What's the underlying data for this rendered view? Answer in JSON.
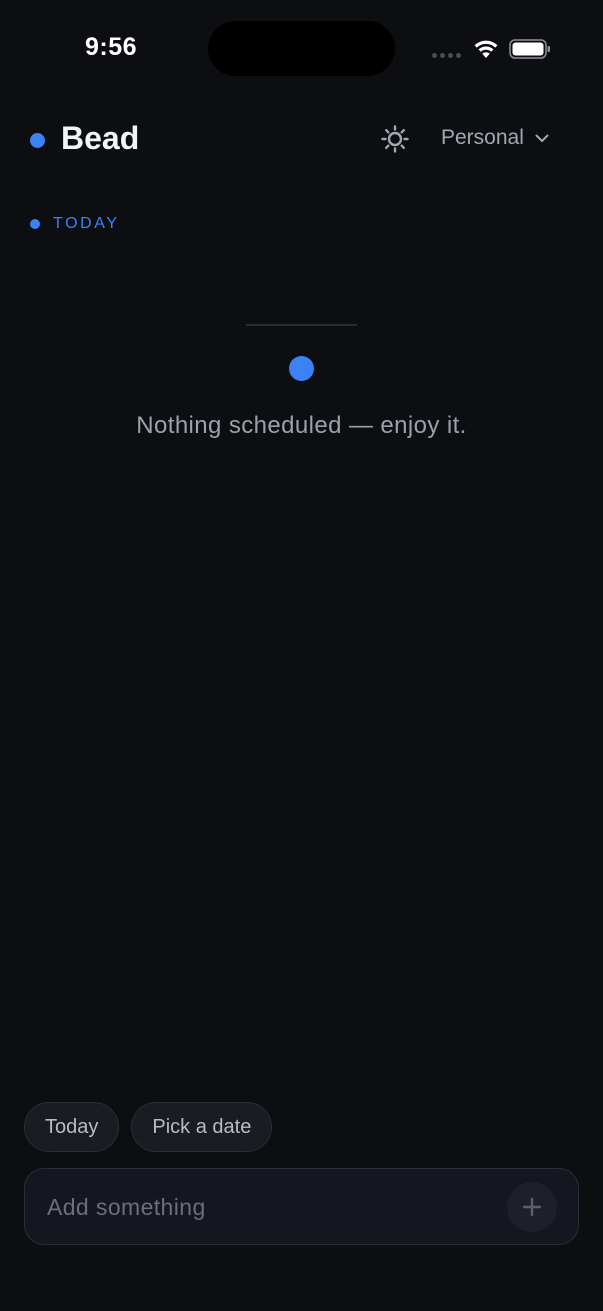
{
  "status_bar": {
    "time": "9:56",
    "icons": [
      "cellular-signal-icon",
      "wifi-icon",
      "battery-icon"
    ]
  },
  "header": {
    "title": "Bead",
    "theme_icon": "sun-icon",
    "profile": "Personal",
    "profile_icon": "chevron-down-icon"
  },
  "section": {
    "label": "TODAY"
  },
  "empty_state": {
    "message": "Nothing scheduled — enjoy it."
  },
  "quick_chips": [
    {
      "label": "Today"
    },
    {
      "label": "Pick a date"
    }
  ],
  "composer": {
    "placeholder": "Add something",
    "value": "",
    "add_icon": "plus-icon"
  },
  "colors": {
    "background": "#0d0e12",
    "accent": "#3b82f6",
    "surface": "#141620",
    "chip": "#1a1c22",
    "muted_text": "#9ca0aa"
  }
}
